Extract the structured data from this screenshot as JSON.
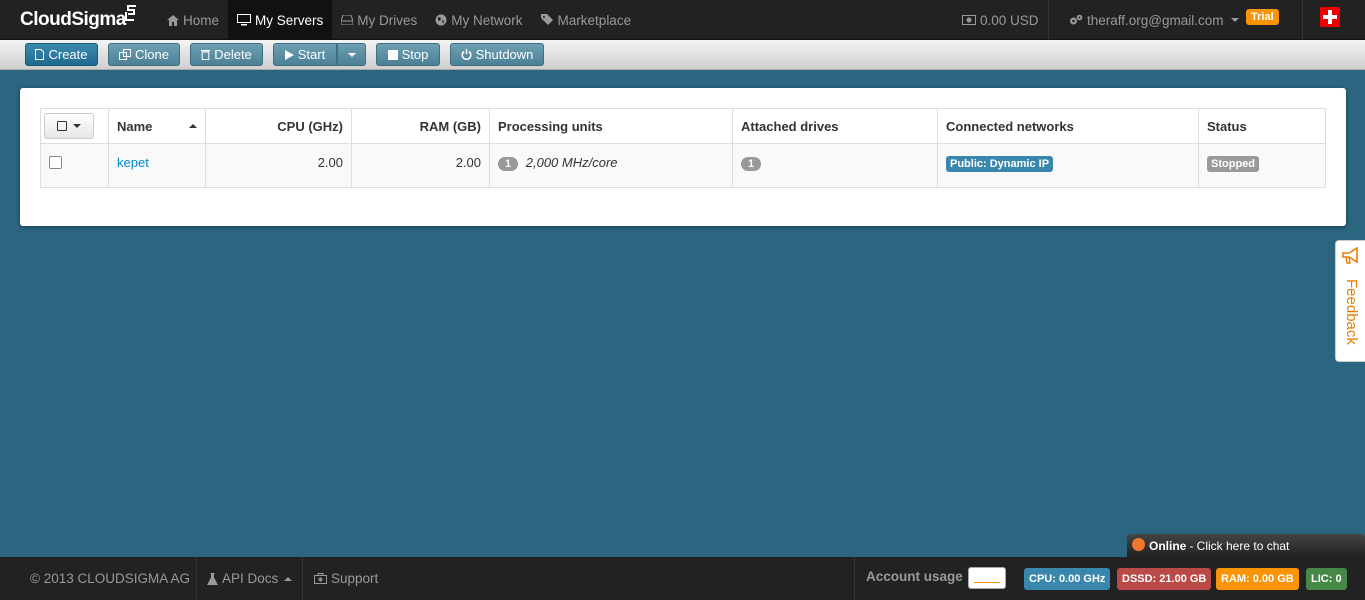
{
  "app": {
    "logo_text": "CloudSigma"
  },
  "nav": {
    "items": [
      {
        "label": "Home",
        "icon": "home-icon"
      },
      {
        "label": "My Servers",
        "icon": "monitor-icon",
        "active": true
      },
      {
        "label": "My Drives",
        "icon": "drive-icon"
      },
      {
        "label": "My Network",
        "icon": "globe-icon"
      },
      {
        "label": "Marketplace",
        "icon": "tag-icon"
      }
    ],
    "balance": "0.00 USD",
    "user_email": "theraff.org@gmail.com",
    "trial_badge": "Trial"
  },
  "toolbar": {
    "create": "Create",
    "clone": "Clone",
    "delete": "Delete",
    "start": "Start",
    "stop": "Stop",
    "shutdown": "Shutdown"
  },
  "table": {
    "headers": {
      "name": "Name",
      "cpu": "CPU (GHz)",
      "ram": "RAM (GB)",
      "processing_units": "Processing units",
      "attached_drives": "Attached drives",
      "connected_networks": "Connected networks",
      "status": "Status"
    },
    "rows": [
      {
        "name": "kepet",
        "cpu": "2.00",
        "ram": "2.00",
        "processing_count": "1",
        "processing_detail": "2,000 MHz/core",
        "drives_count": "1",
        "network": "Public: Dynamic IP",
        "status": "Stopped"
      }
    ]
  },
  "feedback": {
    "label": "Feedback"
  },
  "chat": {
    "status": "Online",
    "text": "- Click here to chat"
  },
  "footer": {
    "copyright": "© 2013 CLOUDSIGMA AG",
    "api_docs": "API Docs",
    "support": "Support",
    "account_usage": "Account usage",
    "metrics": {
      "cpu": "CPU: 0.00 GHz",
      "dssd": "DSSD: 21.00 GB",
      "ram": "RAM: 0.00 GB",
      "lic": "LIC: 0"
    }
  },
  "colors": {
    "background": "#2b6580",
    "accent": "#3a87ad",
    "trial": "#f89406",
    "feedback": "#e87e04",
    "metric_cpu": "#3a87ad",
    "metric_dssd": "#b94a48",
    "metric_ram": "#f89406",
    "metric_lic": "#468847"
  }
}
